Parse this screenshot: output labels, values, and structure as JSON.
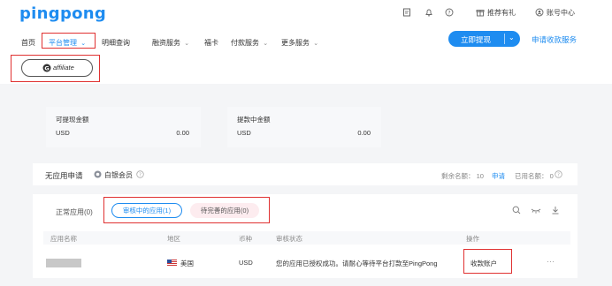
{
  "header": {
    "logo": "pingpong",
    "links": [
      "推荐有礼",
      "账号中心"
    ],
    "icons": [
      "clipboard-icon",
      "bell-icon",
      "help-icon",
      "gift-icon",
      "user-icon"
    ]
  },
  "nav": {
    "items": [
      "首页",
      "平台管理",
      "明细查询",
      "融资服务",
      "福卡",
      "付款服务",
      "更多服务"
    ],
    "primary_button": "立即提现",
    "secondary_link": "申请收款服务"
  },
  "affiliate": {
    "label": "affiliate"
  },
  "balances": [
    {
      "title": "可提现金额",
      "currency": "USD",
      "amount": "0.00"
    },
    {
      "title": "提款中金额",
      "currency": "USD",
      "amount": "0.00"
    }
  ],
  "app_section": {
    "title": "无应用申请",
    "member_label": "白银会员",
    "remaining_label": "剩余名额：",
    "remaining_value": "10",
    "apply_link": "申请",
    "used_label": "已用名额：",
    "used_value": "0"
  },
  "tabs": [
    "正常应用(0)",
    "审核中的应用(1)",
    "待完善的应用(0)"
  ],
  "table": {
    "headers": [
      "应用名称",
      "地区",
      "币种",
      "审核状态",
      "操作"
    ],
    "rows": [
      {
        "region": "美国",
        "currency": "USD",
        "status": "您的应用已授权成功。请耐心等待平台打款至PingPong",
        "action": "收款账户",
        "more": "···"
      }
    ]
  },
  "colors": {
    "accent": "#1e8cf0",
    "highlight": "#e03131",
    "tab_pink": "#fdecef"
  }
}
